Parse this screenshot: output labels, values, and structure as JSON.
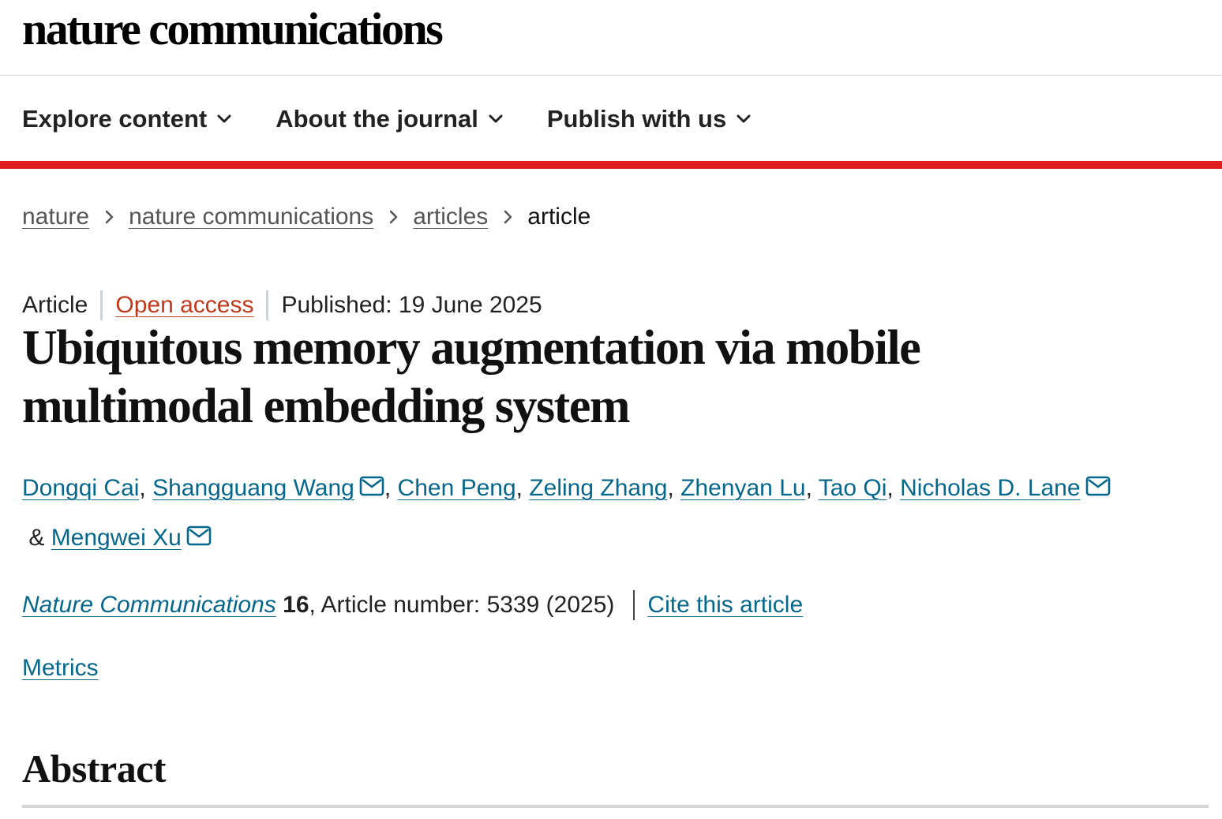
{
  "brand": {
    "logo_text": "nature communications"
  },
  "nav": {
    "items": [
      {
        "label": "Explore content",
        "icon": "chevron-down-icon"
      },
      {
        "label": "About the journal",
        "icon": "chevron-down-icon"
      },
      {
        "label": "Publish with us",
        "icon": "chevron-down-icon"
      }
    ]
  },
  "breadcrumb": {
    "items": [
      "nature",
      "nature communications",
      "articles"
    ],
    "current": "article"
  },
  "article": {
    "type": "Article",
    "access": "Open access",
    "published": "Published: 19 June 2025",
    "title": "Ubiquitous memory augmentation via mobile multimodal embedding system",
    "authors": [
      {
        "name": "Dongqi Cai",
        "email": false,
        "sep": ", "
      },
      {
        "name": "Shangguang Wang",
        "email": true,
        "sep": ", "
      },
      {
        "name": "Chen Peng",
        "email": false,
        "sep": ", "
      },
      {
        "name": "Zeling Zhang",
        "email": false,
        "sep": ", "
      },
      {
        "name": "Zhenyan Lu",
        "email": false,
        "sep": ", "
      },
      {
        "name": "Tao Qi",
        "email": false,
        "sep": ", "
      },
      {
        "name": "Nicholas D. Lane",
        "email": true,
        "sep": " & "
      },
      {
        "name": "Mengwei Xu",
        "email": true,
        "sep": ""
      }
    ],
    "citation": {
      "journal": "Nature Communications",
      "volume": "16",
      "details": ", Article number: 5339 (2025)",
      "cite_label": "Cite this article"
    },
    "metrics_label": "Metrics",
    "abstract_heading": "Abstract"
  },
  "colors": {
    "accent_red": "#e02020",
    "link_blue": "#06678c",
    "open_access": "#c0391b",
    "text": "#222222"
  }
}
